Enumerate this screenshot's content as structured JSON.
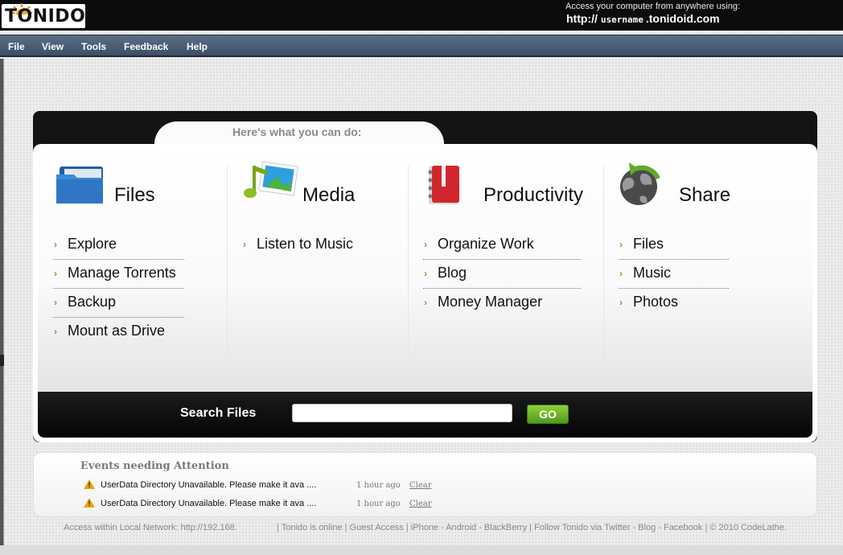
{
  "header": {
    "logo": "TONIDO",
    "access_line1": "Access your computer from anywhere using:",
    "url_prefix": "http://",
    "url_user": "username",
    "url_suffix": ".tonidoid.com"
  },
  "menu": [
    "File",
    "View",
    "Tools",
    "Feedback",
    "Help"
  ],
  "panel": {
    "tab_title": "Here's what you can do:",
    "columns": [
      {
        "title": "Files",
        "icon": "folder-icon",
        "links": [
          "Explore",
          "Manage Torrents",
          "Backup",
          "Mount as Drive"
        ]
      },
      {
        "title": "Media",
        "icon": "music-photo-icon",
        "links": [
          "Listen to Music"
        ]
      },
      {
        "title": "Productivity",
        "icon": "notebook-icon",
        "links": [
          "Organize Work",
          "Blog",
          "Money Manager"
        ]
      },
      {
        "title": "Share",
        "icon": "globe-share-icon",
        "links": [
          "Files",
          "Music",
          "Photos"
        ]
      }
    ],
    "search_label": "Search Files",
    "search_value": "",
    "go_label": "GO"
  },
  "events": {
    "title": "Events needing Attention",
    "items": [
      {
        "message": "UserData Directory Unavailable. Please make it ava ....",
        "time": "1 hour ago",
        "action": "Clear"
      },
      {
        "message": "UserData Directory Unavailable. Please make it ava ....",
        "time": "1 hour ago",
        "action": "Clear"
      }
    ]
  },
  "footer": {
    "local": "Access within Local Network: http://192.168.",
    "sep1": "|",
    "online": "Tonido is online",
    "sep2": "|",
    "guest": "Guest Access",
    "sep3": "|",
    "mobile": "iPhone - Android - BlackBerry",
    "sep4": "|",
    "follow": "Follow Tonido via Twitter - Blog - Facebook",
    "sep5": "|",
    "copyright": "© 2010 CodeLathe."
  },
  "colors": {
    "accent_green": "#6aa52a",
    "menubar": "#4a5d74",
    "go_button": "#6cb52c",
    "warning": "#e8a400"
  }
}
